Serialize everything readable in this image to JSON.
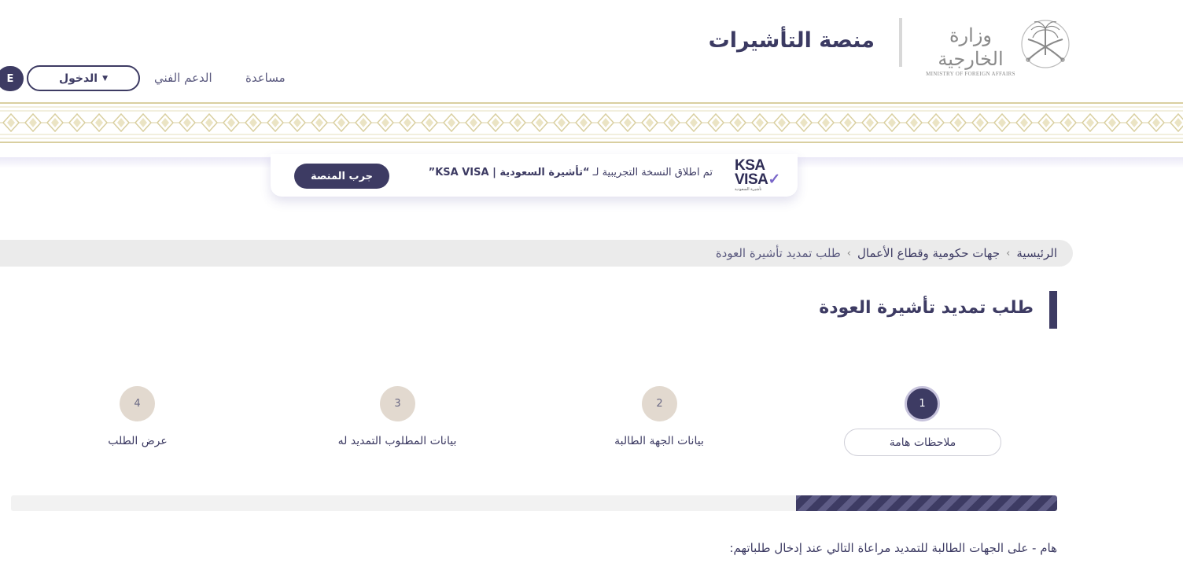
{
  "header": {
    "ministry_arabic": "وزارة الخارجية",
    "ministry_english": "MINISTRY OF FOREIGN AFFAIRS",
    "platform_title": "منصة التأشيرات",
    "nav": {
      "help": "مساعدة",
      "tech_support": "الدعم الفني",
      "login": "الدخول",
      "language": "E"
    }
  },
  "promo": {
    "logo_line1": "KSA",
    "logo_line2": "VISA",
    "logo_sub": "تأشيرة السعودية",
    "text_prefix": "تم اطلاق النسخة التجريبية لـ ",
    "text_highlight": "“تأشيرة السعودية | KSA VISA”",
    "button_label": "جرب المنصة"
  },
  "breadcrumb": {
    "items": [
      "الرئيسية",
      "جهات حكومية وقطاع الأعمال",
      "طلب تمديد تأشيرة العودة"
    ],
    "separator": "›"
  },
  "page": {
    "title": "طلب تمديد تأشيرة العودة"
  },
  "steps": [
    {
      "number": "1",
      "label": "ملاحظات هامة",
      "active": true
    },
    {
      "number": "2",
      "label": "بيانات الجهة الطالبة",
      "active": false
    },
    {
      "number": "3",
      "label": "بيانات المطلوب التمديد له",
      "active": false
    },
    {
      "number": "4",
      "label": "عرض الطلب",
      "active": false
    }
  ],
  "progress": {
    "fraction": 0.25
  },
  "note": "هام - على الجهات الطالبة للتمديد مراعاة التالي عند إدخال طلباتهم:",
  "colors": {
    "primary": "#3d3b63",
    "step_inactive": "#e2d9cf",
    "breadcrumb_bg": "#ebebeb",
    "ornament": "#d9cfa0"
  }
}
